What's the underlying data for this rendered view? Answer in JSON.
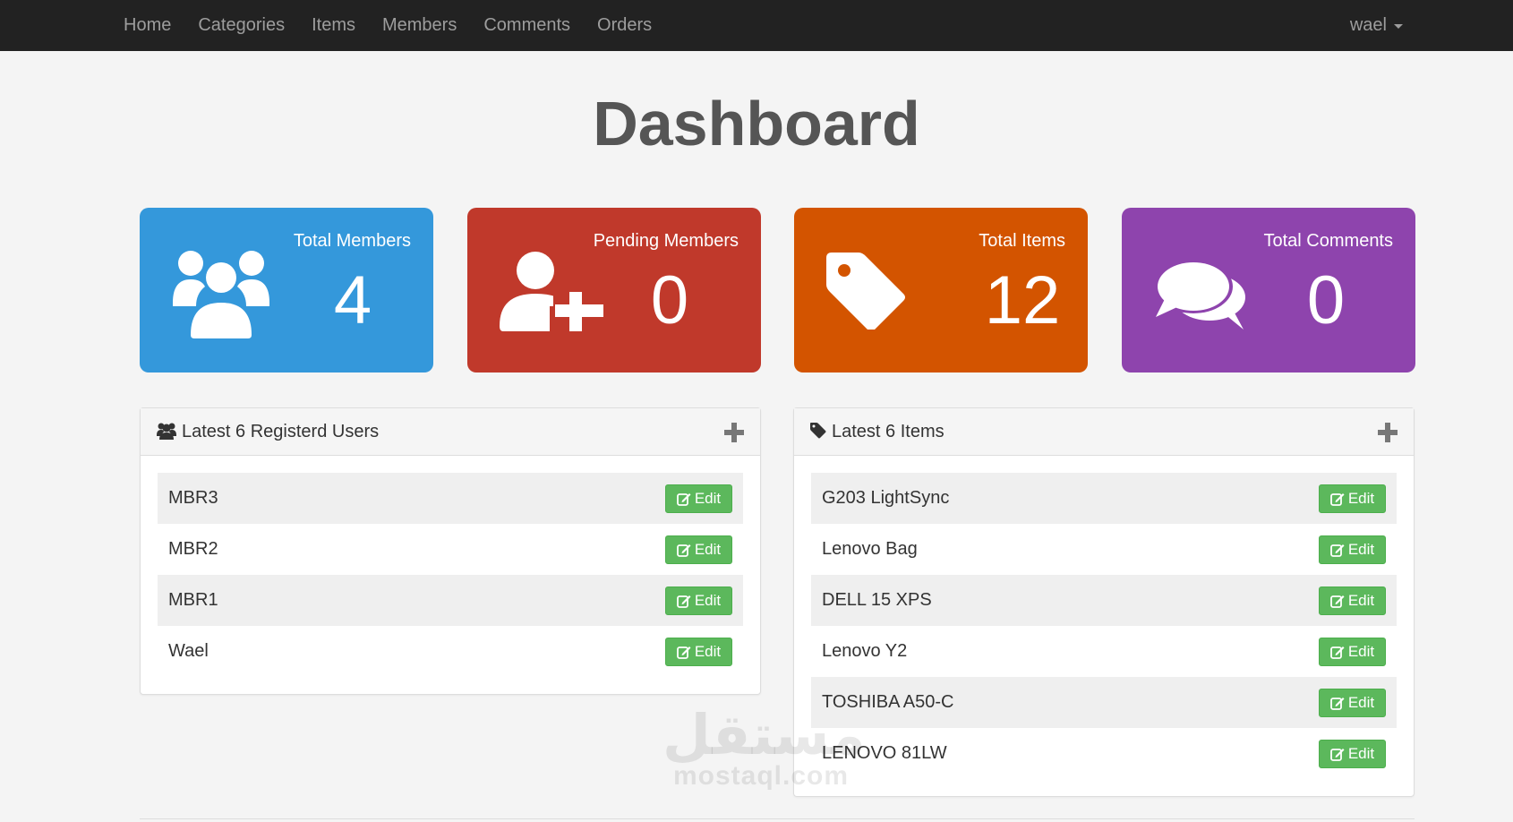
{
  "nav": {
    "links": [
      "Home",
      "Categories",
      "Items",
      "Members",
      "Comments",
      "Orders"
    ],
    "user": "wael"
  },
  "title": "Dashboard",
  "stats": {
    "members": {
      "label": "Total Members",
      "value": "4",
      "color": "#3498db",
      "icon": "users-icon"
    },
    "pending": {
      "label": "Pending Members",
      "value": "0",
      "color": "#c0392b",
      "icon": "user-plus-icon"
    },
    "items": {
      "label": "Total Items",
      "value": "12",
      "color": "#d35400",
      "icon": "tag-icon"
    },
    "comments": {
      "label": "Total Comments",
      "value": "0",
      "color": "#8e44ad",
      "icon": "comments-icon"
    }
  },
  "latest_users": {
    "title": "Latest 6 Registerd Users",
    "rows": [
      "MBR3",
      "MBR2",
      "MBR1",
      "Wael"
    ],
    "edit_label": "Edit"
  },
  "latest_items": {
    "title": "Latest 6 Items",
    "rows": [
      "G203 LightSync",
      "Lenovo Bag",
      "DELL 15 XPS",
      "Lenovo Y2",
      "TOSHIBA A50-C",
      "LENOVO 81LW"
    ],
    "edit_label": "Edit"
  },
  "watermark": {
    "arabic": "مستقل",
    "latin": "mostaql.com"
  },
  "colors": {
    "edit_button": "#5cb85c",
    "navbar": "#222222"
  }
}
